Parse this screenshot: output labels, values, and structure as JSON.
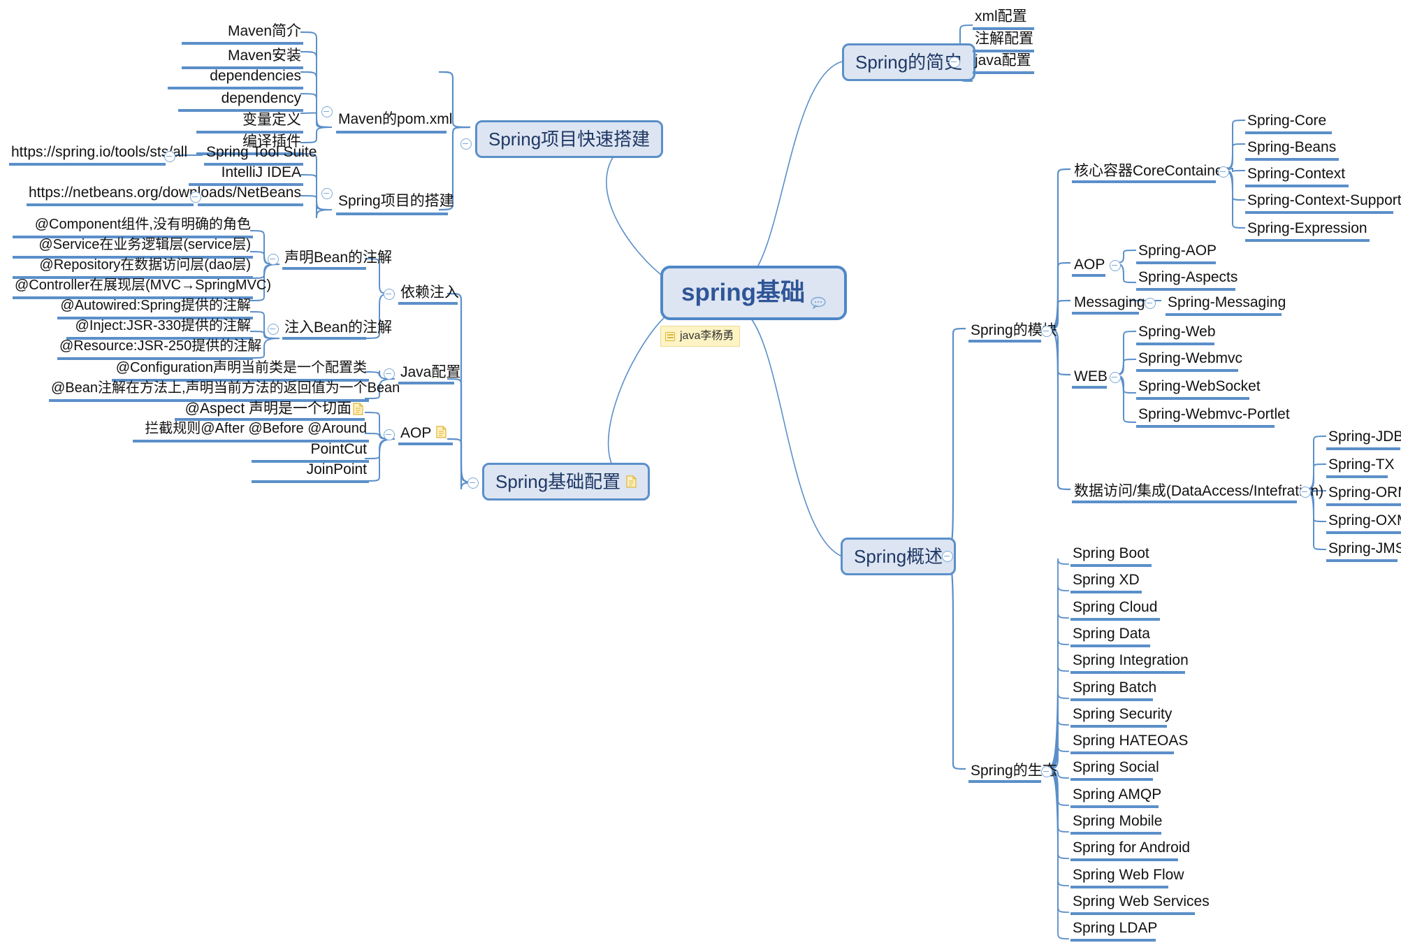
{
  "root": {
    "label": "spring基础",
    "comment_icon": "comment-icon",
    "sticky": {
      "label": "java李杨勇",
      "icon": "note-lines-icon"
    }
  },
  "colors": {
    "node_fill": "#dde5f2",
    "node_border": "#5b8fc9",
    "underline": "#5b8fc9",
    "link": "#5b8fc9",
    "root_text": "#2f5597",
    "sticky_fill": "#fdf3c4",
    "sticky_border": "#e9dc92",
    "note_icon": "#e0b436"
  },
  "branches": {
    "spring_project_quick_setup": {
      "label": "Spring项目快速搭建",
      "children": [
        {
          "label": "Maven的pom.xml",
          "children": [
            {
              "label": "Maven简介"
            },
            {
              "label": "Maven安装"
            },
            {
              "label": "dependencies"
            },
            {
              "label": "dependency"
            },
            {
              "label": "变量定义"
            },
            {
              "label": "编译插件"
            }
          ]
        },
        {
          "label": "Spring项目的搭建",
          "children": [
            {
              "label": "Spring Tool Suite",
              "url": "https://spring.io/tools/sts/all"
            },
            {
              "label": "IntelliJ IDEA"
            },
            {
              "label": "NetBeans",
              "url": "https://netbeans.org/downloads/"
            }
          ]
        }
      ]
    },
    "spring_basic_config": {
      "label": "Spring基础配置",
      "note_icon": "note-icon",
      "children": [
        {
          "label": "依赖注入",
          "children": [
            {
              "label": "声明Bean的注解",
              "children": [
                {
                  "label": "@Component组件,没有明确的角色"
                },
                {
                  "label": "@Service在业务逻辑层(service层)"
                },
                {
                  "label": "@Repository在数据访问层(dao层)"
                },
                {
                  "label": "@Controller在展现层(MVC→SpringMVC)"
                }
              ]
            },
            {
              "label": "注入Bean的注解",
              "children": [
                {
                  "label": "@Autowired:Spring提供的注解"
                },
                {
                  "label": "@Inject:JSR-330提供的注解"
                },
                {
                  "label": "@Resource:JSR-250提供的注解"
                }
              ]
            }
          ]
        },
        {
          "label": "Java配置",
          "children": [
            {
              "label": "@Configuration声明当前类是一个配置类"
            },
            {
              "label": "@Bean注解在方法上,声明当前方法的返回值为一个Bean"
            }
          ]
        },
        {
          "label": "AOP",
          "note_icon": "note-icon",
          "children": [
            {
              "label": "@Aspect 声明是一个切面",
              "note_icon": "note-icon"
            },
            {
              "label": "拦截规则@After @Before @Around"
            },
            {
              "label": "PointCut"
            },
            {
              "label": "JoinPoint"
            }
          ]
        }
      ]
    },
    "spring_history": {
      "label": "Spring的简史",
      "children": [
        {
          "label": "xml配置"
        },
        {
          "label": "注解配置"
        },
        {
          "label": "java配置"
        }
      ]
    },
    "spring_overview": {
      "label": "Spring概述",
      "children": [
        {
          "label": "Spring的模块",
          "children": [
            {
              "label": "核心容器CoreContainer",
              "children": [
                {
                  "label": "Spring-Core"
                },
                {
                  "label": "Spring-Beans"
                },
                {
                  "label": "Spring-Context"
                },
                {
                  "label": "Spring-Context-Support"
                },
                {
                  "label": "Spring-Expression"
                }
              ]
            },
            {
              "label": "AOP",
              "children": [
                {
                  "label": "Spring-AOP"
                },
                {
                  "label": "Spring-Aspects"
                }
              ]
            },
            {
              "label": "Messaging",
              "children": [
                {
                  "label": "Spring-Messaging"
                }
              ]
            },
            {
              "label": "WEB",
              "children": [
                {
                  "label": "Spring-Web"
                },
                {
                  "label": "Spring-Webmvc"
                },
                {
                  "label": "Spring-WebSocket"
                },
                {
                  "label": "Spring-Webmvc-Portlet"
                }
              ]
            },
            {
              "label": "数据访问/集成(DataAccess/Intefration)",
              "children": [
                {
                  "label": "Spring-JDBC"
                },
                {
                  "label": "Spring-TX"
                },
                {
                  "label": "Spring-ORM"
                },
                {
                  "label": "Spring-OXM"
                },
                {
                  "label": "Spring-JMS"
                }
              ]
            }
          ]
        },
        {
          "label": "Spring的生态",
          "children": [
            {
              "label": "Spring Boot"
            },
            {
              "label": "Spring XD"
            },
            {
              "label": "Spring Cloud"
            },
            {
              "label": "Spring Data"
            },
            {
              "label": "Spring Integration"
            },
            {
              "label": "Spring Batch"
            },
            {
              "label": "Spring Security"
            },
            {
              "label": "Spring HATEOAS"
            },
            {
              "label": "Spring Social"
            },
            {
              "label": "Spring AMQP"
            },
            {
              "label": "Spring Mobile"
            },
            {
              "label": "Spring for Android"
            },
            {
              "label": "Spring Web Flow"
            },
            {
              "label": "Spring Web Services"
            },
            {
              "label": "Spring LDAP"
            }
          ]
        }
      ]
    }
  }
}
